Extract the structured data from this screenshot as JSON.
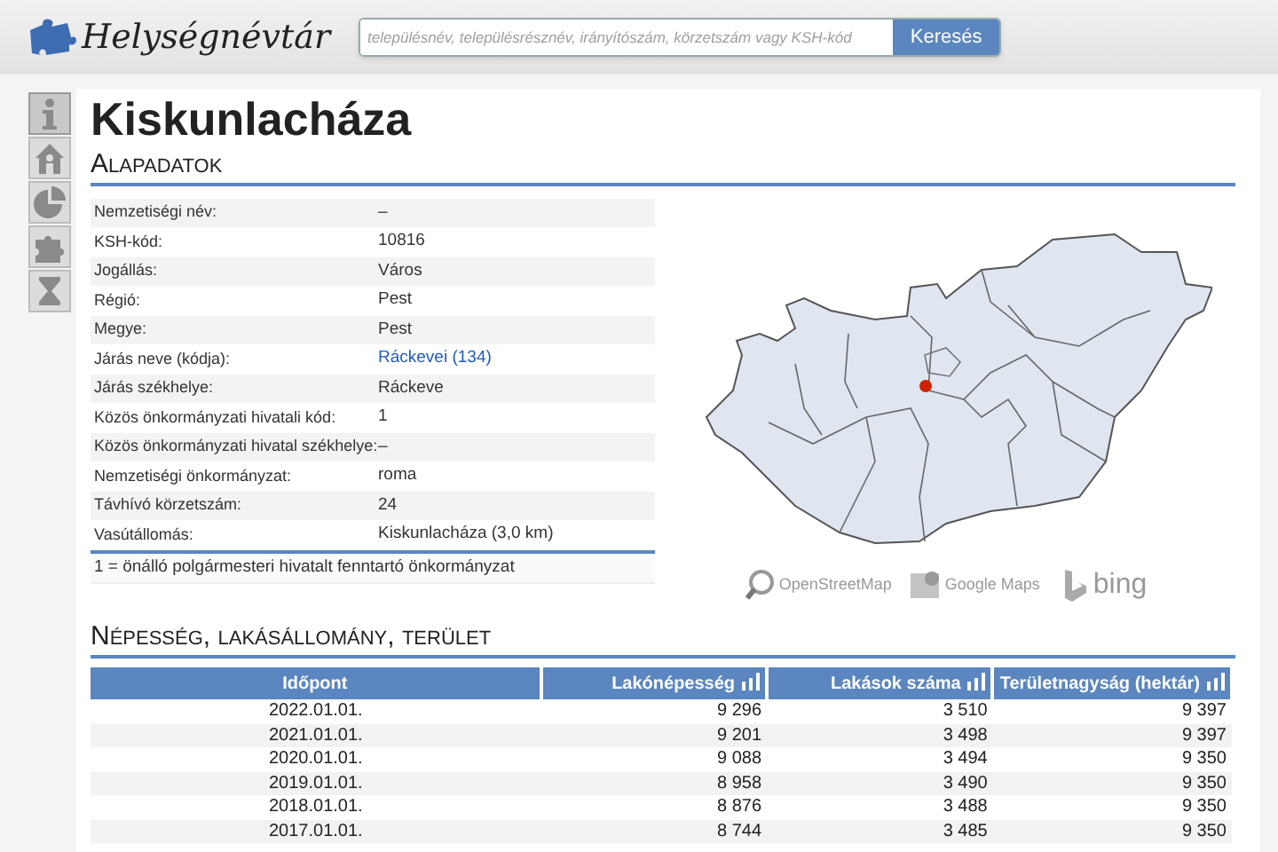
{
  "header": {
    "logo": "Helységnévtár",
    "search": {
      "placeholder": "településnév, településrésznév, irányítószám, körzetszám vagy KSH-kód"
    },
    "search_button": "Keresés"
  },
  "sidebar": {
    "items": [
      {
        "kind": "info",
        "selected": true
      },
      {
        "kind": "home",
        "selected": false
      },
      {
        "kind": "pie",
        "selected": false
      },
      {
        "kind": "puzzle",
        "selected": false
      },
      {
        "kind": "hourglass",
        "selected": false
      }
    ]
  },
  "title": "Kiskunlacháza",
  "basic_section": {
    "heading": "Alapadatok",
    "rows": [
      {
        "label": "Nemzetiségi név:",
        "value": "–",
        "kind": "text"
      },
      {
        "label": "KSH-kód:",
        "value": "10816",
        "kind": "text"
      },
      {
        "label": "Jogállás:",
        "value": "Város",
        "kind": "text"
      },
      {
        "label": "Régió:",
        "value": "Pest",
        "kind": "text"
      },
      {
        "label": "Megye:",
        "value": "Pest",
        "kind": "text"
      },
      {
        "label": "Járás neve (kódja):",
        "value": "Ráckevei (134)",
        "kind": "link"
      },
      {
        "label": "Járás székhelye:",
        "value": "Ráckeve",
        "kind": "text"
      },
      {
        "label": "Közös önkormányzati hivatali kód:",
        "value": "1",
        "kind": "text"
      },
      {
        "label": "Közös önkormányzati hivatal székhelye:",
        "value": "–",
        "kind": "text"
      },
      {
        "label": "Nemzetiségi önkormányzat:",
        "value": "roma",
        "kind": "text"
      },
      {
        "label": "Távhívó körzetszám:",
        "value": "24",
        "kind": "text"
      },
      {
        "label": "Vasútállomás:",
        "value": "Kiskunlacháza (3,0 km)",
        "kind": "text"
      }
    ],
    "footnote": "1 = önálló polgármesteri hivatalt fenntartó önkormányzat"
  },
  "map_links": [
    {
      "kind": "osm",
      "label": "OpenStreetMap"
    },
    {
      "kind": "google",
      "label": "Google Maps"
    },
    {
      "kind": "bing",
      "label": "bing"
    }
  ],
  "population_section": {
    "heading": "Népesség, lakásállomány, terület",
    "columns": [
      {
        "label": "Időpont",
        "chart_button": false
      },
      {
        "label": "Lakónépesség",
        "chart_button": true
      },
      {
        "label": "Lakások száma",
        "chart_button": true
      },
      {
        "label": "Területnagyság (hektár)",
        "chart_button": true
      }
    ],
    "rows": [
      [
        "2022.01.01.",
        "9 296",
        "3 510",
        "9 397"
      ],
      [
        "2021.01.01.",
        "9 201",
        "3 498",
        "9 397"
      ],
      [
        "2020.01.01.",
        "9 088",
        "3 494",
        "9 350"
      ],
      [
        "2019.01.01.",
        "8 958",
        "3 490",
        "9 350"
      ],
      [
        "2018.01.01.",
        "8 876",
        "3 488",
        "9 350"
      ],
      [
        "2017.01.01.",
        "8 744",
        "3 485",
        "9 350"
      ]
    ]
  }
}
